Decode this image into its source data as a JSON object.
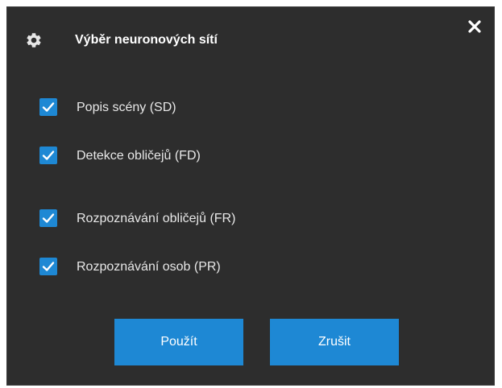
{
  "dialog": {
    "title": "Výběr neuronových sítí",
    "icons": {
      "title": "gear-icon",
      "close": "close-icon",
      "check": "checkmark-icon"
    },
    "options": [
      {
        "label": "Popis scény (SD)",
        "checked": true
      },
      {
        "label": "Detekce obličejů (FD)",
        "checked": true
      },
      {
        "label": "Rozpoznávání obličejů (FR)",
        "checked": true
      },
      {
        "label": "Rozpoznávání osob (PR)",
        "checked": true
      }
    ],
    "buttons": {
      "apply_label": "Použít",
      "cancel_label": "Zrušit"
    }
  },
  "colors": {
    "background": "#2d2d2d",
    "accent": "#1e88d4",
    "text": "#e8e8e8"
  }
}
